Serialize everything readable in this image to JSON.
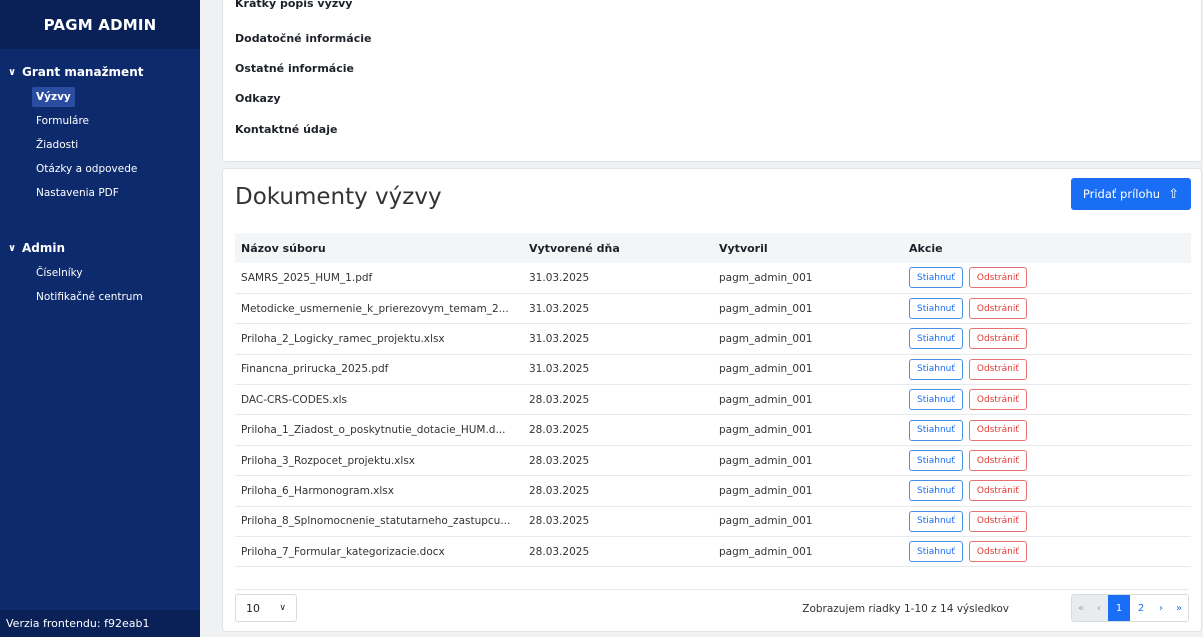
{
  "sidebar": {
    "brand": "PAGM ADMIN",
    "sections": [
      {
        "title": "Grant manažment",
        "items": [
          "Výzvy",
          "Formuláre",
          "Žiadosti",
          "Otázky a odpovede",
          "Nastavenia PDF"
        ],
        "active": "Výzvy"
      },
      {
        "title": "Admin",
        "items": [
          "Číselníky",
          "Notifikačné centrum"
        ]
      }
    ],
    "version": "Verzia frontendu: f92eab1"
  },
  "info_panel": {
    "items": [
      "Krátky popis výzvy",
      "Dodatočné informácie",
      "Ostatné informácie",
      "Odkazy",
      "Kontaktné údaje"
    ]
  },
  "documents": {
    "title": "Dokumenty výzvy",
    "add_button": "Pridať prílohu",
    "columns": [
      "Názov súboru",
      "Vytvorené dňa",
      "Vytvoril",
      "Akcie"
    ],
    "download_label": "Stiahnuť",
    "remove_label": "Odstrániť",
    "rows": [
      {
        "name": "SAMRS_2025_HUM_1.pdf",
        "date": "31.03.2025",
        "user": "pagm_admin_001"
      },
      {
        "name": "Metodicke_usmernenie_k_prierezovym_temam_2...",
        "date": "31.03.2025",
        "user": "pagm_admin_001"
      },
      {
        "name": "Priloha_2_Logicky_ramec_projektu.xlsx",
        "date": "31.03.2025",
        "user": "pagm_admin_001"
      },
      {
        "name": "Financna_prirucka_2025.pdf",
        "date": "31.03.2025",
        "user": "pagm_admin_001"
      },
      {
        "name": "DAC-CRS-CODES.xls",
        "date": "28.03.2025",
        "user": "pagm_admin_001"
      },
      {
        "name": "Priloha_1_Ziadost_o_poskytnutie_dotacie_HUM.d...",
        "date": "28.03.2025",
        "user": "pagm_admin_001"
      },
      {
        "name": "Priloha_3_Rozpocet_projektu.xlsx",
        "date": "28.03.2025",
        "user": "pagm_admin_001"
      },
      {
        "name": "Priloha_6_Harmonogram.xlsx",
        "date": "28.03.2025",
        "user": "pagm_admin_001"
      },
      {
        "name": "Priloha_8_Splnomocnenie_statutarneho_zastupcu...",
        "date": "28.03.2025",
        "user": "pagm_admin_001"
      },
      {
        "name": "Priloha_7_Formular_kategorizacie.docx",
        "date": "28.03.2025",
        "user": "pagm_admin_001"
      }
    ],
    "page_size": "10",
    "rows_info": "Zobrazujem riadky 1-10 z 14 výsledkov",
    "pagination": {
      "first": "«",
      "prev": "‹",
      "pages": [
        "1",
        "2"
      ],
      "current": "1",
      "next": "›",
      "last": "»"
    }
  },
  "colors": {
    "sidebar": "#0d2a6c",
    "brand_bg": "#0a2157",
    "accent": "#1a6ef5",
    "danger": "#e53935"
  }
}
